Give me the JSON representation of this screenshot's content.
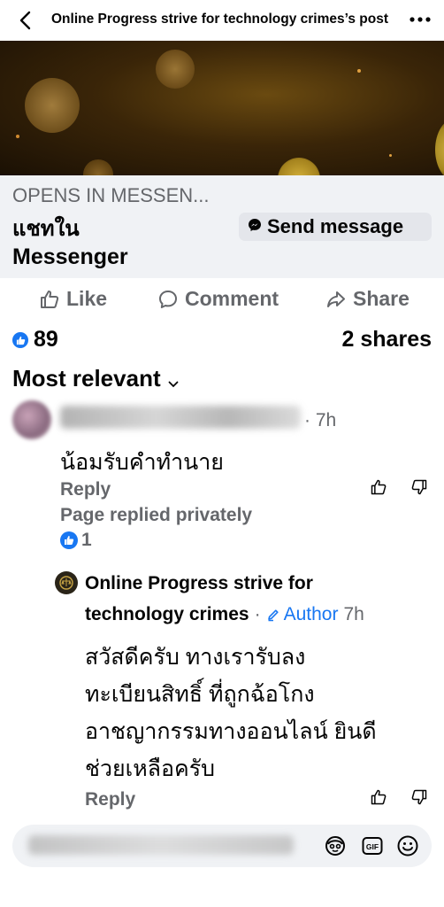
{
  "header": {
    "title": "Online Progress strive for technology crimes’s post"
  },
  "link_preview": {
    "source": "OPENS IN MESSEN...",
    "title_line1": "แชทใน",
    "title_line2": "Messenger",
    "button_label": "Send message"
  },
  "actions": {
    "like": "Like",
    "comment": "Comment",
    "share": "Share"
  },
  "stats": {
    "likes": "89",
    "shares": "2 shares"
  },
  "sort": {
    "label": "Most relevant"
  },
  "comments": [
    {
      "time": "· 7h",
      "text": "น้อมรับคำทำนาย",
      "reply_label": "Reply",
      "page_reply": "Page replied privately",
      "reaction_count": "1"
    },
    {
      "author_line1": "Online Progress strive for",
      "author_line2": "technology crimes",
      "badge": "Author",
      "time": "7h",
      "text_lines": [
        "สวัสดีครับ ทางเรารับลง",
        "ทะเบียนสิทธิ์ ที่ถูกฉ้อโกง",
        "อาชญากรรมทางออนไลน์ ยินดี",
        "ช่วยเหลือครับ"
      ],
      "reply_label": "Reply"
    }
  ],
  "composer": {
    "icons": [
      "avatar-sticker-icon",
      "gif-icon",
      "emoji-icon"
    ]
  },
  "colors": {
    "accent": "#1877f2",
    "muted": "#65676b",
    "surface": "#f0f2f5"
  }
}
